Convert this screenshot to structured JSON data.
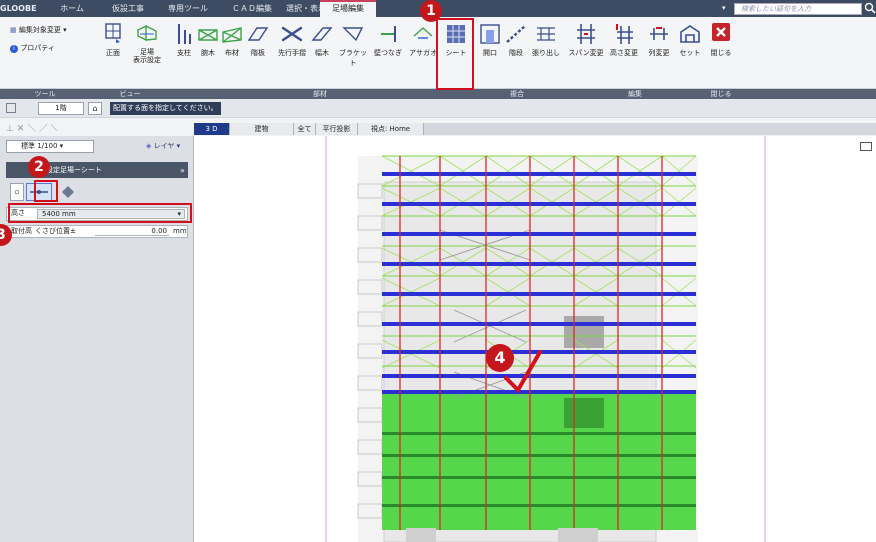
{
  "tabs": [
    "GLOOBE",
    "ホーム",
    "仮設工事",
    "専用ツール",
    "ＣＡＤ編集",
    "選択・表示",
    "足場編集"
  ],
  "search": {
    "placeholder": "検索したい語句を入力"
  },
  "ribbon": {
    "left": {
      "edit_target": "編集対象変更",
      "properties": "プロパティ",
      "front": "正面",
      "display_setting": "足場\n表示設定"
    },
    "members": [
      "支柱",
      "腕木",
      "布材",
      "階板",
      "先行手摺",
      "幅木",
      "ブラケット",
      "壁つなぎ",
      "アサガオ"
    ],
    "sheet": "シート",
    "composite": [
      "開口",
      "階段",
      "張り出し"
    ],
    "edit": [
      "スパン変更",
      "高さ変更",
      "列変更",
      "セット"
    ],
    "close": "閉じる",
    "groups": {
      "tools": "ツール",
      "view": "ビュー",
      "members": "部材",
      "composite": "複合",
      "edit": "編集",
      "close": "閉じる"
    }
  },
  "toolbar": {
    "floor": "1階",
    "hint": "配置する面を指定してください。",
    "scale": "標準 1/100",
    "layer": "レイヤ"
  },
  "panel": {
    "title": "設定足場ーシート",
    "height_label": "高さ",
    "height_value": "5400 mm",
    "attach_label": "取付高",
    "attach_sub": "くさび位置±",
    "attach_value": "0.00",
    "attach_unit": "mm"
  },
  "view_tabs": [
    "3 D",
    "建物",
    "全て",
    "平行投影",
    "視点: Home"
  ],
  "callouts": [
    "1",
    "2",
    "3",
    "4"
  ],
  "colors": {
    "accent": "#c4171c",
    "sheet_green": "#46d43a",
    "scaffold_red": "#e0252b",
    "scaffold_blue": "#2a2fd6"
  }
}
